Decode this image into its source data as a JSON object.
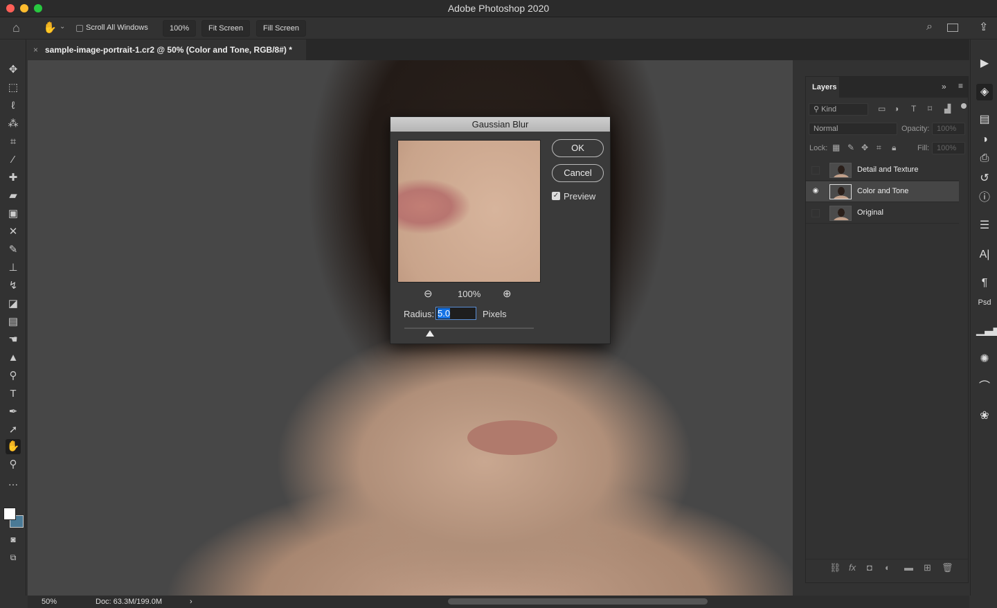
{
  "app": {
    "title": "Adobe Photoshop 2020"
  },
  "options_bar": {
    "scroll_all_windows": "Scroll All Windows",
    "zoom_100": "100%",
    "fit_screen": "Fit Screen",
    "fill_screen": "Fill Screen"
  },
  "document": {
    "tab_title": "sample-image-portrait-1.cr2 @ 50% (Color and Tone, RGB/8#) *"
  },
  "status": {
    "zoom": "50%",
    "doc": "Doc: 63.3M/199.0M"
  },
  "layers_panel": {
    "title": "Layers",
    "filter": "Kind",
    "blend_mode": "Normal",
    "opacity_label": "Opacity:",
    "opacity": "100%",
    "lock_label": "Lock:",
    "fill_label": "Fill:",
    "fill": "100%",
    "layers": [
      {
        "name": "Detail and Texture",
        "visible": false,
        "selected": false
      },
      {
        "name": "Color and Tone",
        "visible": true,
        "selected": true
      },
      {
        "name": "Original",
        "visible": false,
        "selected": false
      }
    ]
  },
  "dialog": {
    "title": "Gaussian Blur",
    "ok": "OK",
    "cancel": "Cancel",
    "preview_label": "Preview",
    "preview_checked": true,
    "zoom": "100%",
    "radius_label": "Radius:",
    "radius": "5.0",
    "units": "Pixels",
    "radius_slider_fraction": 0.2
  },
  "colors": {
    "accent": "#1473e6",
    "foreground": "#ffffff",
    "background": "#4a7a96"
  }
}
